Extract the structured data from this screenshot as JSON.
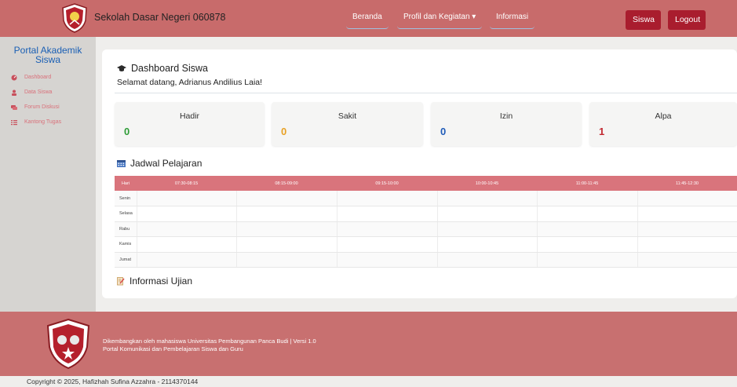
{
  "header": {
    "school_name": "Sekolah Dasar Negeri 060878",
    "nav": {
      "beranda": "Beranda",
      "profil": "Profil dan Kegiatan ▾",
      "informasi": "Informasi"
    },
    "btn_siswa": "Siswa",
    "btn_logout": "Logout"
  },
  "sidebar": {
    "title_line1": "Portal Akademik",
    "title_line2": "Siswa",
    "items": [
      {
        "label": "Dashboard",
        "icon": "dashboard-icon"
      },
      {
        "label": "Data Siswa",
        "icon": "user-icon"
      },
      {
        "label": "Forum Diskusi",
        "icon": "chat-icon"
      },
      {
        "label": "Kantong Tugas",
        "icon": "list-icon"
      }
    ]
  },
  "dashboard": {
    "title": "Dashboard Siswa",
    "welcome": "Selamat datang, Adrianus Andilius Laia!",
    "stats": [
      {
        "label": "Hadir",
        "value": "0",
        "color": "#2e9c37"
      },
      {
        "label": "Sakit",
        "value": "0",
        "color": "#e8a125"
      },
      {
        "label": "Izin",
        "value": "0",
        "color": "#1f5bb8"
      },
      {
        "label": "Alpa",
        "value": "1",
        "color": "#c22a32"
      }
    ]
  },
  "jadwal": {
    "title": "Jadwal Pelajaran",
    "headers": [
      "Hari",
      "07:30-08:15",
      "08:15-09:00",
      "09:15-10:00",
      "10:00-10:45",
      "11:00-11:45",
      "11:45-12:30"
    ],
    "days": [
      "Senin",
      "Selasa",
      "Rabu",
      "Kamis",
      "Jumat"
    ]
  },
  "ujian": {
    "title": "Informasi Ujian"
  },
  "footer": {
    "line1": "Dikembangkan oleh mahasiswa Universitas Pembangunan Panca Budi | Versi 1.0",
    "line2": "Portal Komunikasi dan Pembelajaran Siswa dan Guru"
  },
  "copyright": "Copyright © 2025, Hafizhah Sufina Azzahra - 2114370144"
}
